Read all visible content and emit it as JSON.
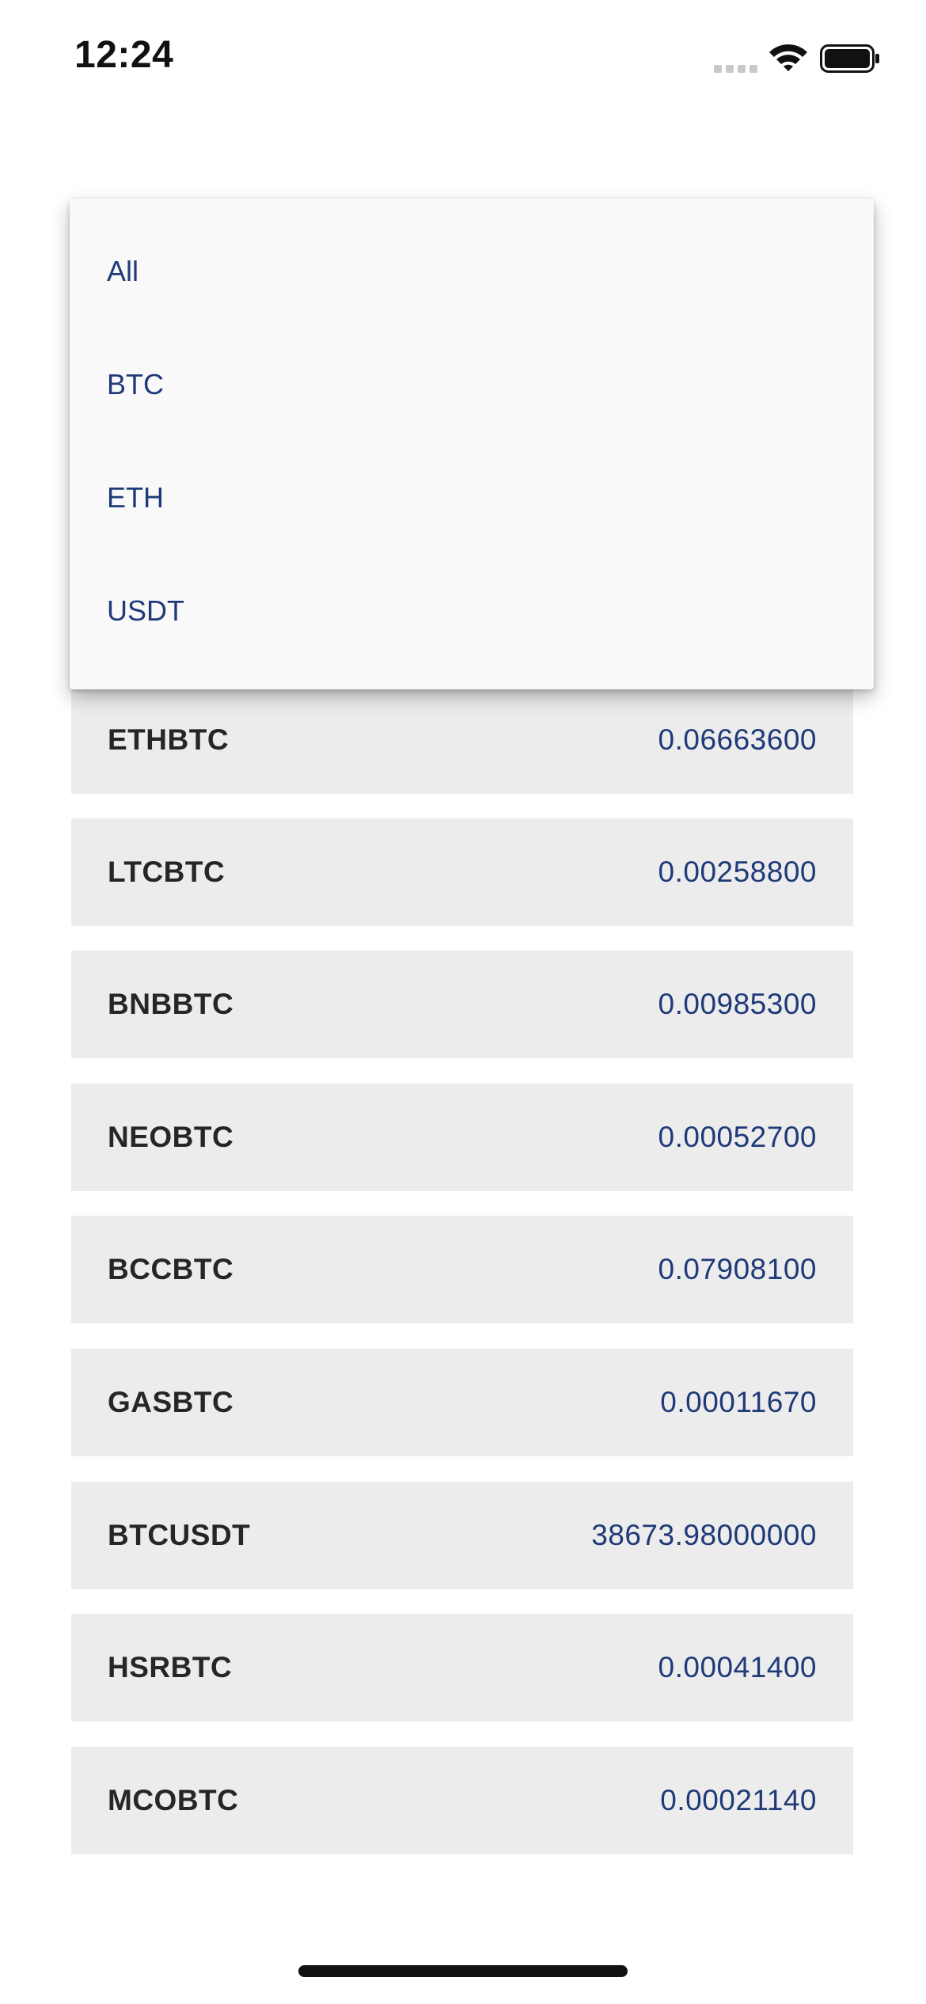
{
  "status_bar": {
    "time": "12:24"
  },
  "dropdown": {
    "options": [
      "All",
      "BTC",
      "ETH",
      "USDT"
    ]
  },
  "tickers": [
    {
      "symbol": "ETHBTC",
      "price": "0.06663600"
    },
    {
      "symbol": "LTCBTC",
      "price": "0.00258800"
    },
    {
      "symbol": "BNBBTC",
      "price": "0.00985300"
    },
    {
      "symbol": "NEOBTC",
      "price": "0.00052700"
    },
    {
      "symbol": "BCCBTC",
      "price": "0.07908100"
    },
    {
      "symbol": "GASBTC",
      "price": "0.00011670"
    },
    {
      "symbol": "BTCUSDT",
      "price": "38673.98000000"
    },
    {
      "symbol": "HSRBTC",
      "price": "0.00041400"
    },
    {
      "symbol": "MCOBTC",
      "price": "0.00021140"
    }
  ],
  "colors": {
    "accent_text": "#1f3a78",
    "row_background": "#ececec",
    "menu_background": "#f9f9f9"
  }
}
